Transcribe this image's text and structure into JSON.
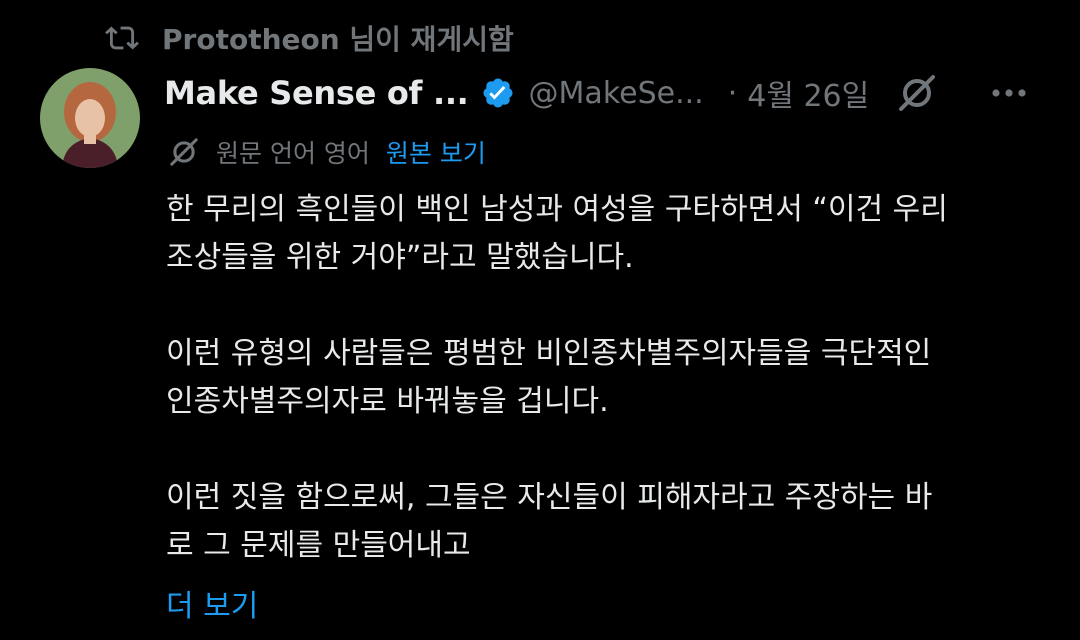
{
  "repost": {
    "label": "Prototheon 님이 재게시함"
  },
  "author": {
    "display_name": "Make Sense of ...",
    "handle": "@MakeSe...",
    "separator": "·",
    "date": "4월 26일"
  },
  "translation": {
    "note": "원문 언어 영어",
    "view_original": "원본 보기"
  },
  "tweet": {
    "paragraphs": [
      {
        "lines": [
          "한 무리의 흑인들이 백인 남성과 여성을 구타하면서 “이건 우리",
          "조상들을 위한 거야”라고 말했습니다."
        ]
      },
      {
        "lines": [
          "이런 유형의 사람들은 평범한 비인종차별주의자들을 극단적인",
          "인종차별주의자로 바꿔놓을 겁니다."
        ]
      },
      {
        "lines": [
          "이런 짓을 함으로써, 그들은 자신들이 피해자라고 주장하는 바",
          "로 그 문제를 만들어내고"
        ]
      }
    ],
    "show_more": "더 보기"
  },
  "colors": {
    "background": "#000000",
    "text_primary": "#e7e9ea",
    "text_secondary": "#71767b",
    "accent_blue": "#1d9bf0",
    "avatar_bg": "#7fa06a"
  },
  "icons": {
    "repost": "repost-icon",
    "verified": "verified-badge-icon",
    "grok": "grok-icon",
    "more": "more-horizontal-icon",
    "translate": "translate-icon"
  }
}
